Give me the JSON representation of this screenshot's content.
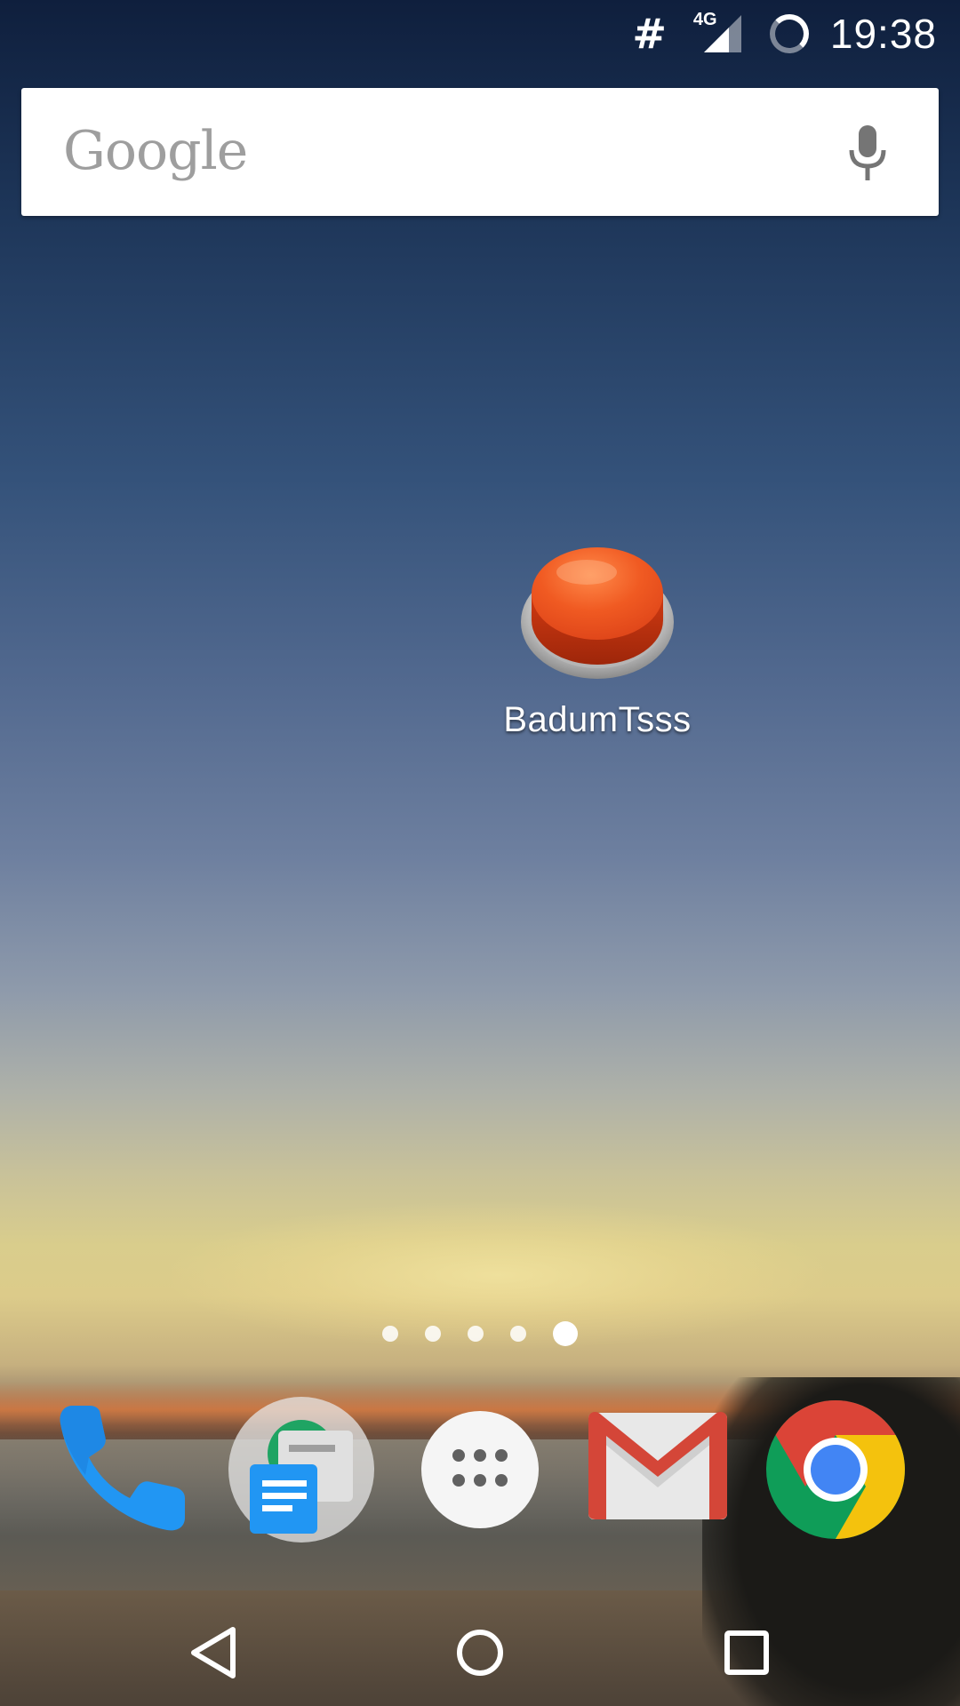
{
  "status_bar": {
    "hash_symbol": "#",
    "network_type": "4G",
    "time": "19:38"
  },
  "search_bar": {
    "logo_text": "Google",
    "mic_icon": "microphone-icon"
  },
  "home_apps": [
    {
      "label": "BadumTsss",
      "icon": "red-button-icon"
    }
  ],
  "page_indicator": {
    "total_pages": 5,
    "active_page": 5
  },
  "dock": [
    {
      "name": "Phone",
      "icon": "phone-icon"
    },
    {
      "name": "Messenger",
      "icon": "messages-icon"
    },
    {
      "name": "Apps",
      "icon": "app-drawer-icon"
    },
    {
      "name": "Gmail",
      "icon": "gmail-icon"
    },
    {
      "name": "Chrome",
      "icon": "chrome-icon"
    }
  ],
  "nav_bar": {
    "back_icon": "back-triangle-icon",
    "home_icon": "home-circle-icon",
    "recents_icon": "recents-square-icon"
  },
  "colors": {
    "badumtsss_button": "#e8501f",
    "phone_blue": "#2196f3",
    "gmail_red": "#d44638",
    "chrome_red": "#db4437",
    "chrome_yellow": "#f4c20d",
    "chrome_green": "#0f9d58",
    "chrome_blue": "#4285f4"
  }
}
